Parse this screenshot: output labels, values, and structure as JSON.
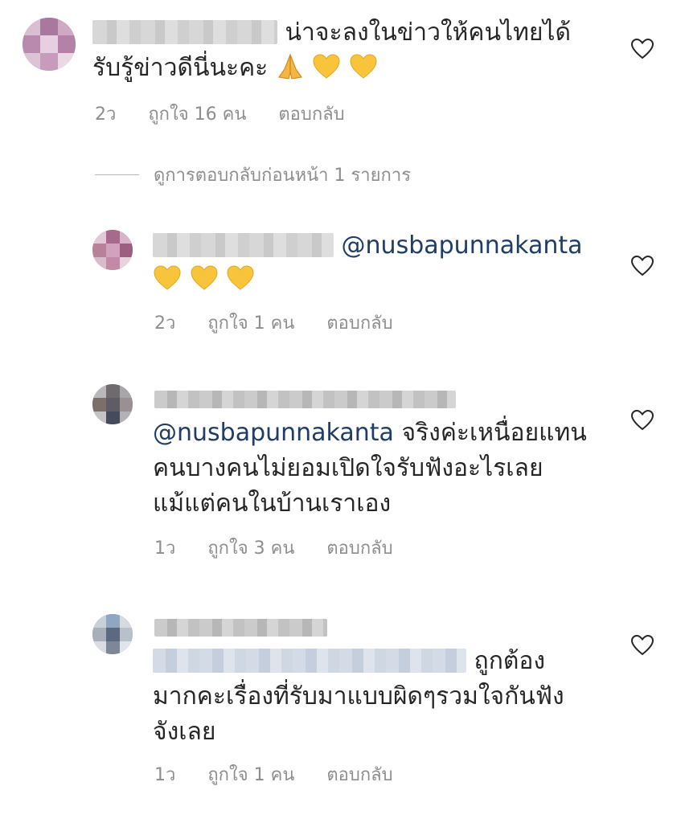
{
  "comments": [
    {
      "text_line1": "น่าจะลงในข่าวให้คนไทยได้",
      "text_line2": "รับรู้ข่าวดีนี่นะคะ",
      "emoji": [
        "pray",
        "yellow-heart",
        "yellow-heart"
      ],
      "time": "2ว",
      "likes": "ถูกใจ 16 คน",
      "reply": "ตอบกลับ"
    },
    {
      "mention": "@nusbapunnakanta",
      "emoji": [
        "yellow-heart",
        "yellow-heart",
        "yellow-heart"
      ],
      "time": "2ว",
      "likes": "ถูกใจ 1 คน",
      "reply": "ตอบกลับ"
    },
    {
      "mention": "@nusbapunnakanta",
      "text_line1": " จริงค่ะเหนื่อยแทน",
      "text_line2": "คนบางคนไม่ยอมเปิดใจรับฟังอะไรเลย",
      "text_line3": "แม้แต่คนในบ้านเราเอง",
      "time": "1ว",
      "likes": "ถูกใจ 3 คน",
      "reply": "ตอบกลับ"
    },
    {
      "text_line1": "ถูกต้อง",
      "text_line2": "มากคะเรื่องที่รับมาแบบผิดๆรวมใจกันฟัง",
      "text_line3": "จังเลย",
      "time": "1ว",
      "likes": "ถูกใจ 1 คน",
      "reply": "ตอบกลับ"
    }
  ],
  "view_previous": "ดูการตอบกลับก่อนหน้า 1 รายการ",
  "colors": {
    "mention": "#1f3d66",
    "meta": "#8e8e8e",
    "heart": "#262626",
    "yellow_heart": "#f7c43b"
  }
}
